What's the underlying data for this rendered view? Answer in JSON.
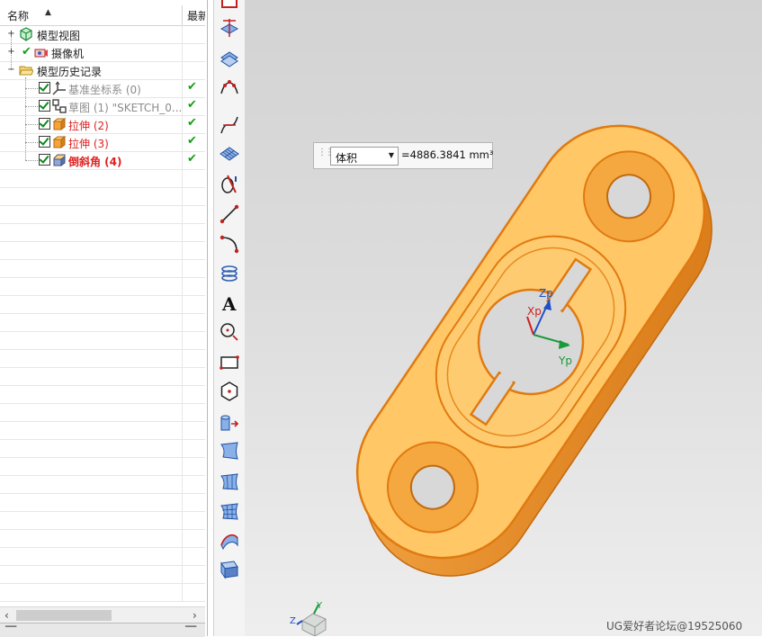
{
  "navigator": {
    "header": {
      "name": "名称",
      "last_col": "最新"
    },
    "nodes": [
      {
        "label": "模型视图",
        "status": "",
        "style": "normal"
      },
      {
        "label": "摄像机",
        "status": "",
        "style": "normal"
      },
      {
        "label": "模型历史记录",
        "status": "",
        "style": "normal"
      },
      {
        "label": "基准坐标系 (0)",
        "status": "✔",
        "style": "grey"
      },
      {
        "label": "草图 (1) \"SKETCH_0...",
        "status": "✔",
        "style": "grey"
      },
      {
        "label": "拉伸 (2)",
        "status": "✔",
        "style": "red"
      },
      {
        "label": "拉伸 (3)",
        "status": "✔",
        "style": "red"
      },
      {
        "label": "倒斜角 (4)",
        "status": "✔",
        "style": "redb"
      }
    ]
  },
  "toolbar": {
    "icons": [
      "datum-plane-icon",
      "datum-plane-2-icon",
      "datum-plane-3-icon",
      "point-set-icon",
      "curve-intersect-icon",
      "mesh-surface-icon",
      "section-icon",
      "line-icon",
      "arc-icon",
      "helix-icon",
      "text-icon",
      "circle-point-icon",
      "rectangle-icon",
      "polygon-icon",
      "extrude-curve-icon",
      "surface-icon",
      "studio-surface-icon",
      "surface-grid-icon",
      "swept-surface-icon",
      "face-blend-icon"
    ]
  },
  "measure": {
    "type_option": "体积",
    "value": "=4886.3841 mm³"
  },
  "csys": {
    "z": "Zp",
    "x": "Xp",
    "y": "Yp"
  },
  "triad": {
    "y": "Y",
    "z": "Z"
  },
  "watermark": "UG爱好者论坛@19525060",
  "colors": {
    "part_fill": "#ffc766",
    "part_edge": "#e07a10",
    "check": "#16a016",
    "feature_red": "#e02020"
  }
}
